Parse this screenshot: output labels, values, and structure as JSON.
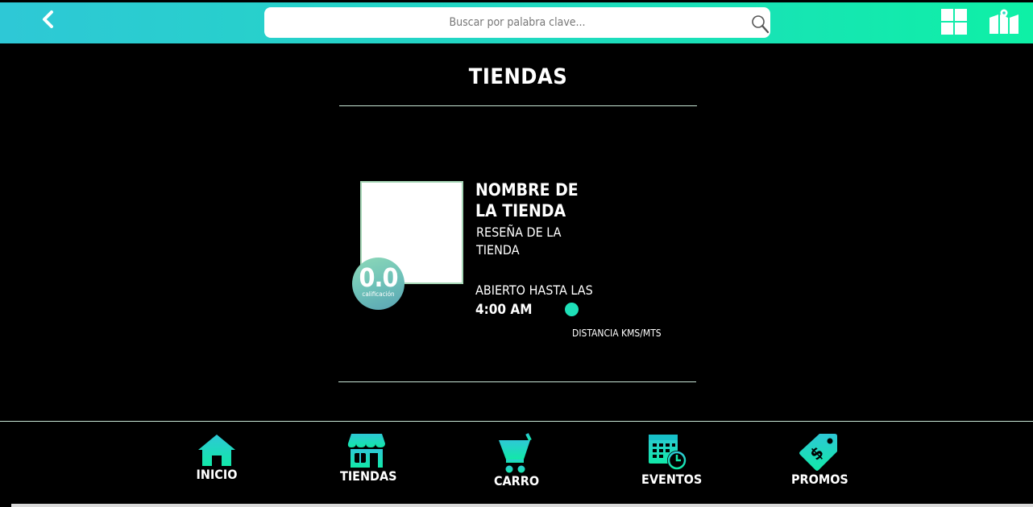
{
  "colors": {
    "accent": "#1ee0b8",
    "header_start": "#2ec8d6",
    "header_end": "#0ef0a6"
  },
  "header": {
    "back_icon": "chevron-left-icon",
    "search_placeholder": "Buscar por palabra clave...",
    "search_icon": "search-icon",
    "grid_icon": "grid-view-icon",
    "map_icon": "map-icon"
  },
  "main": {
    "title": "TIENDAS",
    "store": {
      "name": "NOMBRE DE LA TIENDA",
      "review": "RESEÑA DE LA TIENDA",
      "rating_value": "0.0",
      "rating_label": "calificación",
      "open_label": "ABIERTO HASTA LAS",
      "open_time": "4:00 AM",
      "distance": "DISTANCIA KMS/MTS"
    }
  },
  "bottom_nav": {
    "items": [
      {
        "label": "INICIO",
        "icon": "home-icon"
      },
      {
        "label": "TIENDAS",
        "icon": "store-icon"
      },
      {
        "label": "CARRO",
        "icon": "cart-icon"
      },
      {
        "label": "EVENTOS",
        "icon": "calendar-clock-icon"
      },
      {
        "label": "PROMOS",
        "icon": "price-tag-icon"
      }
    ]
  }
}
